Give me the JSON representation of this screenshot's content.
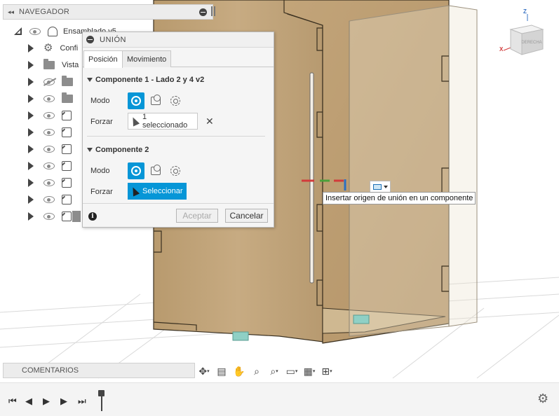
{
  "navigator": {
    "title": "NAVEGADOR",
    "collapse_glyph": "◂◂",
    "items": [
      {
        "label": "Ensamblado v5",
        "icon": "assembly-icon"
      },
      {
        "label": "Confi",
        "icon": "gear-icon"
      },
      {
        "label": "Vista",
        "icon": "folder-icon"
      },
      {
        "label": "",
        "icon": "folder-icon",
        "hidden": true
      },
      {
        "label": "",
        "icon": "folder-icon"
      },
      {
        "label": "",
        "icon": "component-icon"
      },
      {
        "label": "",
        "icon": "component-icon"
      },
      {
        "label": "",
        "icon": "component-icon"
      },
      {
        "label": "",
        "icon": "component-icon"
      },
      {
        "label": "",
        "icon": "component-icon"
      },
      {
        "label": "",
        "icon": "component-icon"
      },
      {
        "label": "",
        "icon": "component-icon"
      }
    ]
  },
  "dialog": {
    "title": "UNIÓN",
    "tabs": [
      "Posición",
      "Movimiento"
    ],
    "active_tab": "Posición",
    "component1": {
      "heading": "Componente 1 - Lado 2 y 4 v2",
      "mode_label": "Modo",
      "force_label": "Forzar",
      "selection": "1 seleccionado",
      "clear_glyph": "✕"
    },
    "component2": {
      "heading": "Componente 2",
      "mode_label": "Modo",
      "force_label": "Forzar",
      "selection": "Seleccionar"
    },
    "info_glyph": "i",
    "ok_label": "Aceptar",
    "cancel_label": "Cancelar",
    "accent_color": "#0696d7"
  },
  "tooltip": {
    "text": "Insertar origen de unión en un componente"
  },
  "viewcube": {
    "face": "DERECHA",
    "z_label": "Z",
    "x_label": "X"
  },
  "comments": {
    "label": "COMENTARIOS"
  },
  "nav_toolbar": {
    "icons": [
      "orbit-icon",
      "look-at-icon",
      "pan-icon",
      "zoom-icon",
      "fit-icon",
      "display-settings-icon",
      "grid-icon",
      "viewports-icon"
    ]
  },
  "timeline": {
    "icons": [
      "go-to-start-icon",
      "step-back-icon",
      "play-icon",
      "step-forward-icon",
      "go-to-end-icon"
    ]
  }
}
